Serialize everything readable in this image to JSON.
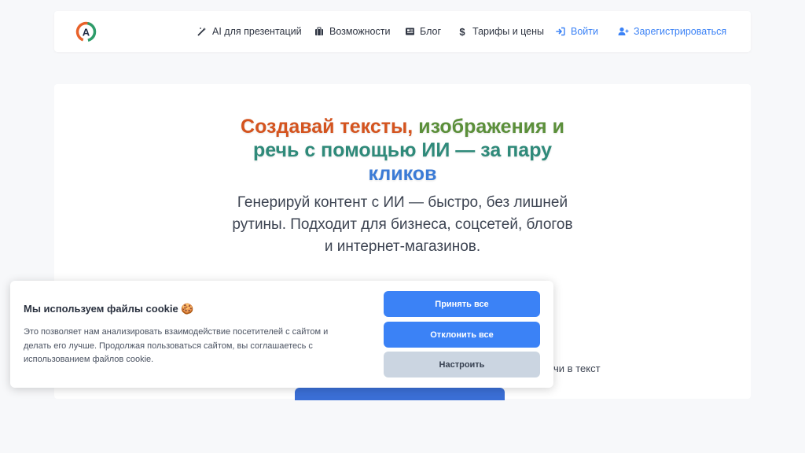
{
  "nav": {
    "logo_letter": "A",
    "items": [
      {
        "label": "AI для презентаций",
        "icon": "magic-wand-icon"
      },
      {
        "label": "Возможности",
        "icon": "briefcase-icon"
      },
      {
        "label": "Блог",
        "icon": "newspaper-icon"
      },
      {
        "label": "Тарифы и цены",
        "icon": "dollar-icon"
      },
      {
        "label": "Войти",
        "icon": "sign-in-icon"
      },
      {
        "label": "Зарегистрироваться",
        "icon": "user-plus-icon"
      }
    ]
  },
  "hero": {
    "title_part1": "Создавай тексты,",
    "title_part2": "изображения и",
    "title_part3": "речь с помощью ИИ — за пару",
    "title_part4": "кликов",
    "subtitle": "Генерируй контент с ИИ — быстро, без лишней рутины. Подходит для бизнеса, соцсетей, блогов и интернет-магазинов.",
    "feature_text": "речи в текст"
  },
  "cookie": {
    "title": "Мы используем файлы cookie 🍪",
    "text": "Это позволяет нам анализировать взаимодействие посетителей с сайтом и делать его лучше. Продолжая пользоваться сайтом, вы соглашаетесь с использованием файлов cookie.",
    "accept_label": "Принять все",
    "reject_label": "Отклонить все",
    "settings_label": "Настроить"
  },
  "colors": {
    "accent": "#3b82f6",
    "title_orange": "#d4541f",
    "title_green": "#5b8f3a",
    "title_teal": "#2f8a7a",
    "title_blue": "#3b7bd6"
  }
}
